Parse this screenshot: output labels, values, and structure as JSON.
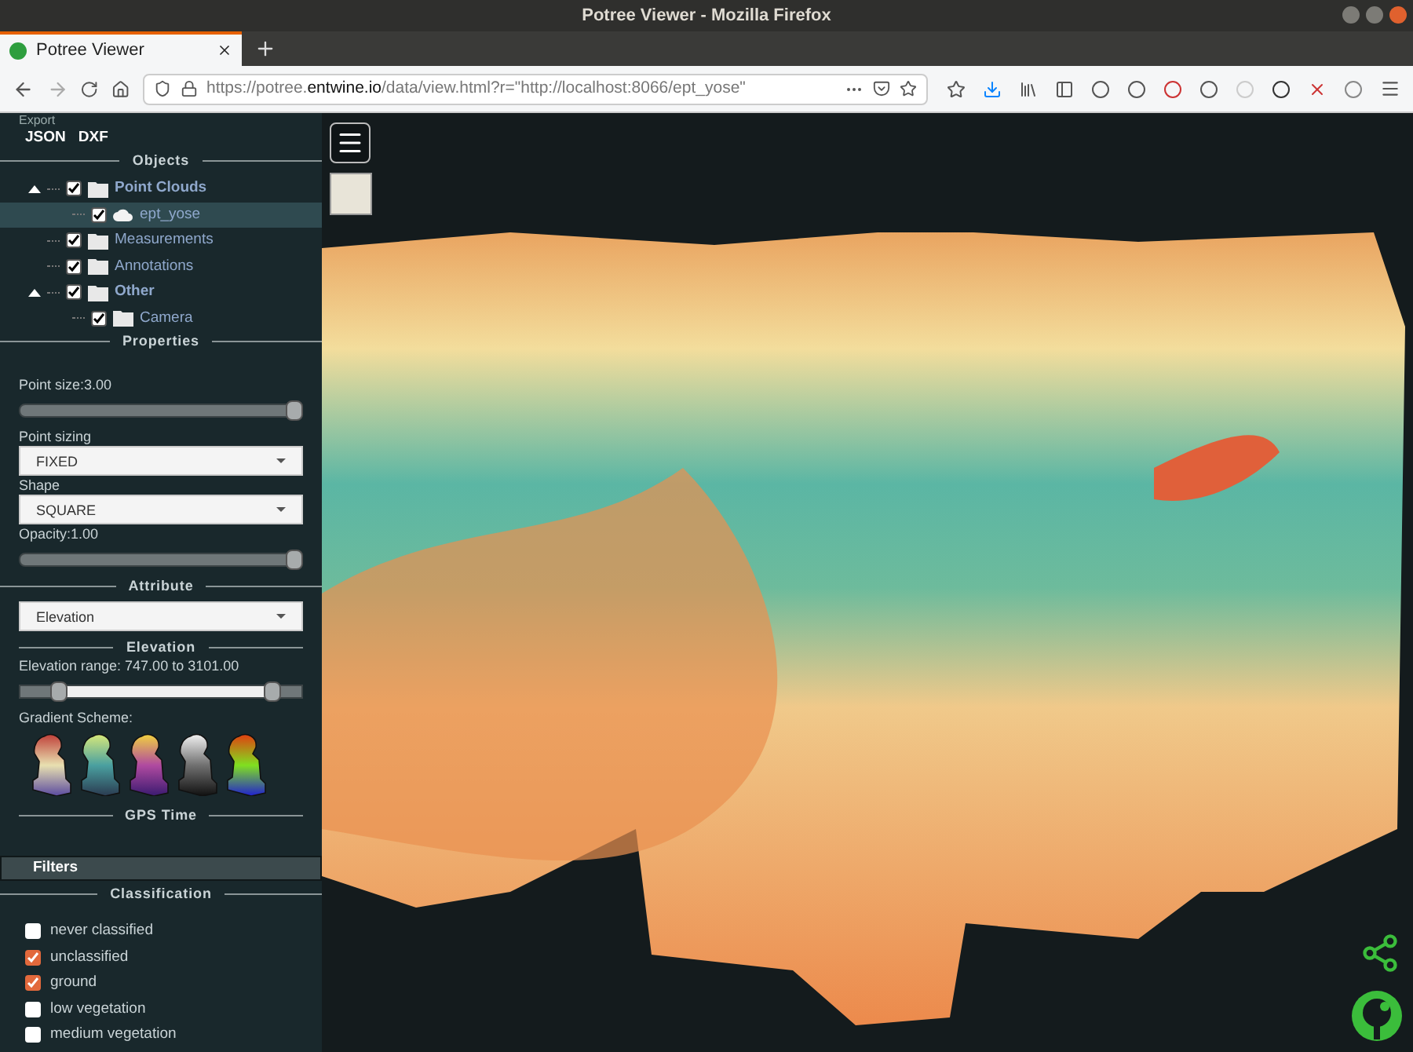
{
  "window": {
    "title": "Potree Viewer - Mozilla Firefox"
  },
  "tabs": [
    {
      "label": "Potree Viewer",
      "selected": true
    }
  ],
  "url": {
    "prefix": "https://potree.",
    "domain": "entwine.io",
    "path": "/data/view.html?r=\"http://localhost:8066/ept_yose\""
  },
  "sidebar": {
    "export": {
      "label": "Export",
      "buttons": [
        "JSON",
        "DXF"
      ]
    },
    "objects": {
      "heading": "Objects",
      "tree": [
        {
          "label": "Point Clouds",
          "kind": "folder",
          "checked": true,
          "expanded": true,
          "selected": false,
          "children": [
            {
              "label": "ept_yose",
              "kind": "cloud",
              "checked": true,
              "selected": true
            }
          ]
        },
        {
          "label": "Measurements",
          "kind": "folder",
          "checked": true,
          "selected": false
        },
        {
          "label": "Annotations",
          "kind": "folder",
          "checked": true,
          "selected": false
        },
        {
          "label": "Other",
          "kind": "folder",
          "checked": true,
          "expanded": true,
          "selected": false,
          "children": [
            {
              "label": "Camera",
              "kind": "folder",
              "checked": true,
              "selected": false
            }
          ]
        }
      ]
    },
    "properties": {
      "heading": "Properties",
      "point_size": {
        "label": "Point size:3.00",
        "level": 1
      },
      "point_sizing": {
        "label": "Point sizing",
        "value": "FIXED"
      },
      "shape": {
        "label": "Shape",
        "value": "SQUARE"
      },
      "opacity": {
        "label": "Opacity:1.00",
        "level": 1
      }
    },
    "attribute": {
      "heading": "Attribute",
      "value": "Elevation"
    },
    "elevation": {
      "heading": "Elevation",
      "range_label": "Elevation range: 747.00 to 3101.00",
      "thumbs": [
        {
          "level": 0.12
        },
        {
          "level": 0.92
        }
      ],
      "gradient_label": "Gradient Scheme:"
    },
    "gps_time": {
      "heading": "GPS Time"
    },
    "filters": {
      "label": "Filters"
    },
    "classification": {
      "heading": "Classification",
      "items": [
        {
          "label": "never classified",
          "checked": false
        },
        {
          "label": "unclassified",
          "checked": true
        },
        {
          "label": "ground",
          "checked": true
        },
        {
          "label": "low vegetation",
          "checked": false
        },
        {
          "label": "medium vegetation",
          "checked": false
        }
      ]
    }
  }
}
